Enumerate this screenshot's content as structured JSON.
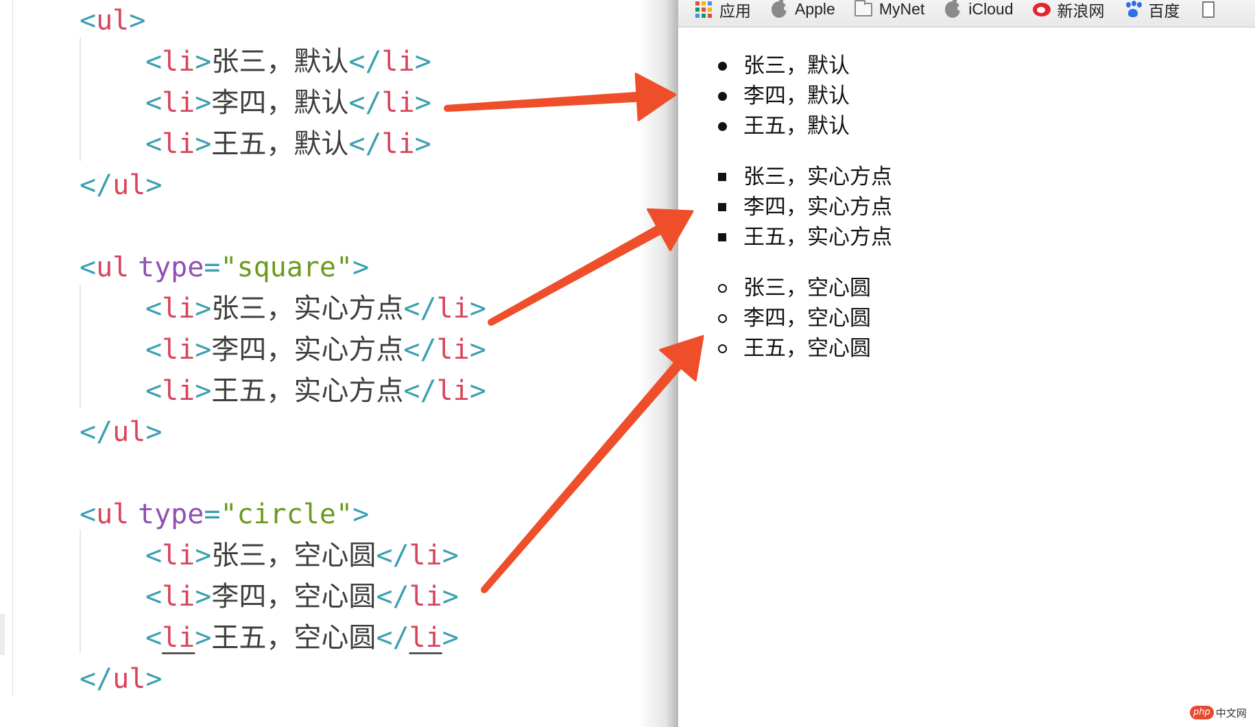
{
  "editor": {
    "lines": [
      {
        "kind": "open",
        "tag": "ul",
        "attr": "",
        "val": ""
      },
      {
        "kind": "li",
        "text": "张三，默认"
      },
      {
        "kind": "li",
        "text": "李四，默认"
      },
      {
        "kind": "li",
        "text": "王五，默认"
      },
      {
        "kind": "close",
        "tag": "ul"
      },
      {
        "kind": "blank"
      },
      {
        "kind": "open",
        "tag": "ul",
        "attr": "type",
        "val": "square"
      },
      {
        "kind": "li",
        "text": "张三，实心方点"
      },
      {
        "kind": "li",
        "text": "李四，实心方点"
      },
      {
        "kind": "li",
        "text": "王五，实心方点"
      },
      {
        "kind": "close",
        "tag": "ul"
      },
      {
        "kind": "blank"
      },
      {
        "kind": "open",
        "tag": "ul",
        "attr": "type",
        "val": "circle"
      },
      {
        "kind": "li",
        "text": "张三，空心圆"
      },
      {
        "kind": "li",
        "text": "李四，空心圆"
      },
      {
        "kind": "li",
        "text": "王五，空心圆",
        "underline": true
      },
      {
        "kind": "close",
        "tag": "ul"
      }
    ]
  },
  "bookmarks": [
    {
      "icon": "apps-grid-icon",
      "label": "应用"
    },
    {
      "icon": "apple-icon",
      "label": "Apple"
    },
    {
      "icon": "folder-icon",
      "label": "MyNet"
    },
    {
      "icon": "apple-icon",
      "label": "iCloud"
    },
    {
      "icon": "weibo-icon",
      "label": "新浪网"
    },
    {
      "icon": "baidu-icon",
      "label": "百度"
    },
    {
      "icon": "document-icon",
      "label": ""
    }
  ],
  "preview": {
    "lists": [
      {
        "type": "disc",
        "items": [
          "张三，默认",
          "李四，默认",
          "王五，默认"
        ]
      },
      {
        "type": "square",
        "items": [
          "张三，实心方点",
          "李四，实心方点",
          "王五，实心方点"
        ]
      },
      {
        "type": "circle",
        "items": [
          "张三，空心圆",
          "李四，空心圆",
          "王五，空心圆"
        ]
      }
    ]
  },
  "colors": {
    "arrow": "#ee4f2a",
    "tag_bracket": "#3a9fb0",
    "tag_name": "#d8445a",
    "attr_name": "#8f4fb3",
    "attr_value": "#6b9a1e"
  },
  "watermark": {
    "logo": "php",
    "text": "中文网"
  }
}
